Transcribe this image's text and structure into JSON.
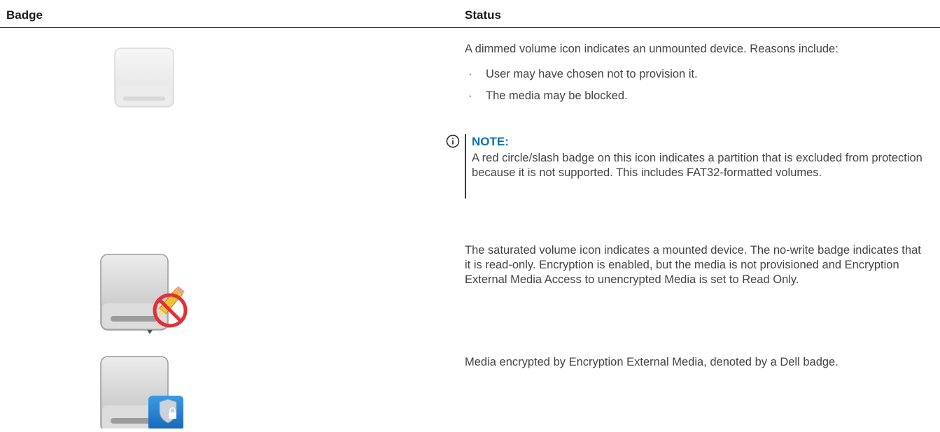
{
  "table": {
    "headers": {
      "badge": "Badge",
      "status": "Status"
    },
    "rows": [
      {
        "icon": "dimmed-volume-icon",
        "text": "A dimmed volume icon indicates an unmounted device. Reasons include:",
        "bullets": [
          "User may have chosen not to provision it.",
          "The media may be blocked."
        ],
        "note": {
          "title": "NOTE:",
          "text": "A red circle/slash badge on this icon indicates a partition that is excluded from protection because it is not supported. This includes FAT32-formatted volumes."
        }
      },
      {
        "icon": "no-write-badge-volume-icon",
        "text": "The saturated volume icon indicates a mounted device. The no-write badge indicates that it is read-only. Encryption is enabled, but the media is not provisioned and Encryption External Media Access to unencrypted Media is set to Read Only."
      },
      {
        "icon": "dell-badge-volume-icon",
        "text": "Media encrypted by Encryption External Media, denoted by a Dell badge."
      }
    ]
  },
  "colors": {
    "note_title": "#0a70b7",
    "note_bar": "#1f3b73",
    "no_write_badge": "#e0303a",
    "dell_badge": "#1f78d1"
  }
}
